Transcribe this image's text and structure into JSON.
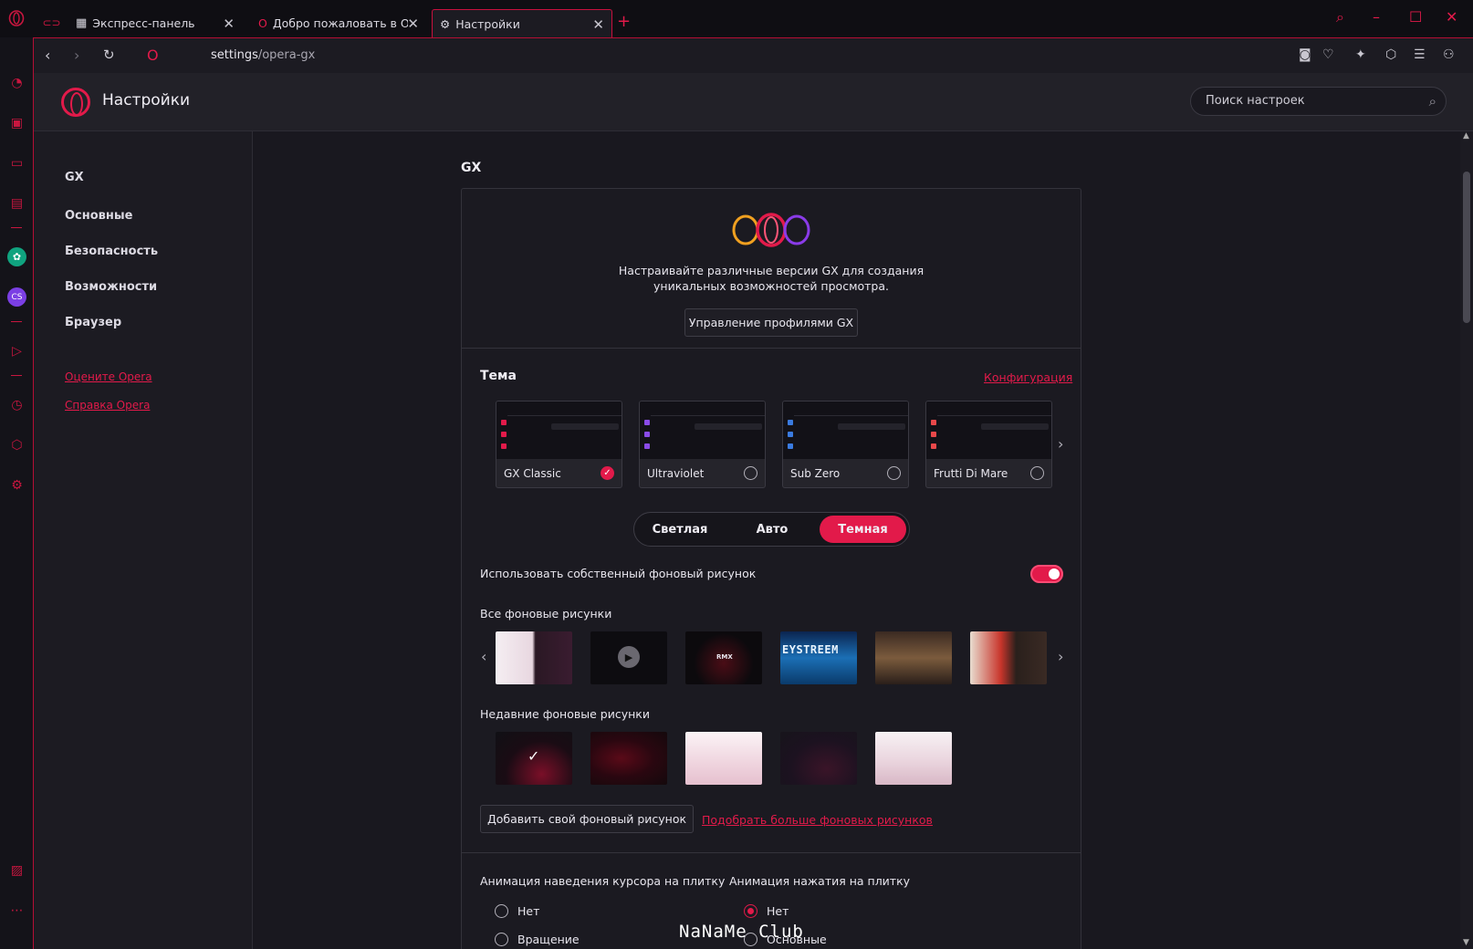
{
  "tabs": [
    {
      "title": "Экспресс-панель",
      "icon": "grid-icon"
    },
    {
      "title": "Добро пожаловать в Opera",
      "icon": "opera-icon"
    },
    {
      "title": "Настройки",
      "icon": "gear-icon",
      "active": true
    }
  ],
  "address": {
    "host": "settings",
    "path": "/opera-gx"
  },
  "header": {
    "title": "Настройки",
    "search_placeholder": "Поиск настроек"
  },
  "nav": {
    "items": [
      "GX",
      "Основные",
      "Безопасность",
      "Возможности",
      "Браузер"
    ],
    "links": [
      "Оцените Opera",
      "Справка Opera"
    ]
  },
  "gx": {
    "section_title": "GX",
    "intro_line1": "Настраивайте различные версии GX для создания",
    "intro_line2": "уникальных возможностей просмотра.",
    "manage_button": "Управление профилями GX"
  },
  "theme": {
    "title": "Тема",
    "config_link": "Конфигурация",
    "cards": [
      {
        "name": "GX Classic",
        "accent": "#e21a4a",
        "selected": true
      },
      {
        "name": "Ultraviolet",
        "accent": "#8a4be8",
        "selected": false
      },
      {
        "name": "Sub Zero",
        "accent": "#3a7be0",
        "selected": false
      },
      {
        "name": "Frutti Di Mare",
        "accent": "#e8484a",
        "selected": false
      }
    ],
    "modes": [
      "Светлая",
      "Авто",
      "Темная"
    ],
    "active_mode": "Темная"
  },
  "wallpaper": {
    "custom_label": "Использовать собственный фоновый рисунок",
    "custom_enabled": true,
    "all_label": "Все фоновые рисунки",
    "recent_label": "Недавние фоновые рисунки",
    "add_button": "Добавить свой фоновый рисунок",
    "more_link": "Подобрать больше фоновых рисунков",
    "all_thumb_text": [
      "",
      "",
      "RMX",
      "EYSTREEM",
      "",
      ""
    ]
  },
  "animations": {
    "hover_title": "Анимация наведения курсора на плитку",
    "hover_options": [
      "Нет",
      "Вращение"
    ],
    "hover_selected": null,
    "click_title": "Анимация нажатия на плитку",
    "click_options": [
      "Нет",
      "Основные"
    ],
    "click_selected": "Нет"
  },
  "watermark": "NaNaMe Club",
  "colors": {
    "accent": "#e21a4a",
    "background": "#19181f"
  }
}
